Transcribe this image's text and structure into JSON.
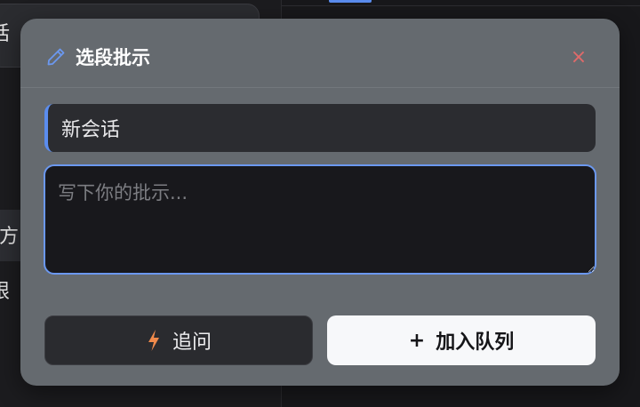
{
  "background": {
    "sidebar_card_text": "话",
    "sidebar_item_1": "方",
    "sidebar_item_2": "限"
  },
  "dialog": {
    "title": "选段批示",
    "title_icon": "pencil-icon",
    "close_icon": "close-icon",
    "close_glyph": "×",
    "session_name": "新会话",
    "instruction_placeholder": "写下你的批示...",
    "instruction_value": "",
    "followup_label": "追问",
    "followup_icon": "bolt-icon",
    "queue_icon_glyph": "+",
    "queue_label": "加入队列"
  },
  "colors": {
    "accent": "#5b8def",
    "dialog_bg": "#656a6f",
    "close": "#e06a6a",
    "bolt": "#f08a4b"
  }
}
